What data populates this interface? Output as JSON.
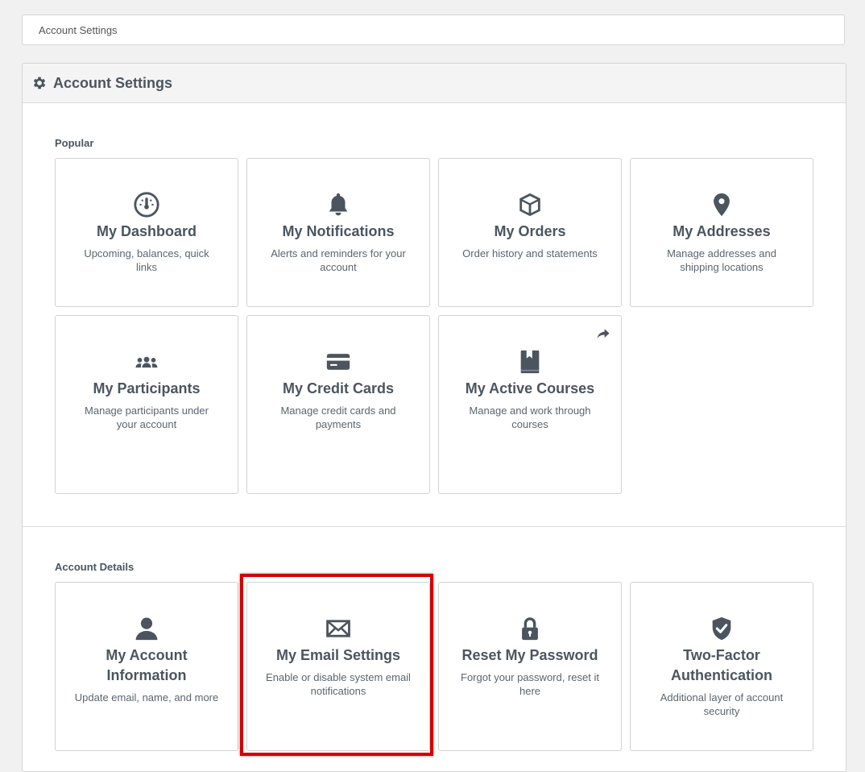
{
  "breadcrumb": {
    "label": "Account Settings"
  },
  "panel": {
    "title": "Account Settings",
    "icon": "gear-icon"
  },
  "sections": {
    "popular": {
      "label": "Popular",
      "cards": [
        {
          "title": "My Dashboard",
          "desc": "Upcoming, balances, quick links",
          "icon": "dashboard-gauge-icon"
        },
        {
          "title": "My Notifications",
          "desc": "Alerts and reminders for your account",
          "icon": "bell-icon"
        },
        {
          "title": "My Orders",
          "desc": "Order history and statements",
          "icon": "box-icon"
        },
        {
          "title": "My Addresses",
          "desc": "Manage addresses and shipping locations",
          "icon": "map-pin-icon"
        },
        {
          "title": "My Participants",
          "desc": "Manage participants under your account",
          "icon": "users-icon"
        },
        {
          "title": "My Credit Cards",
          "desc": "Manage credit cards and payments",
          "icon": "credit-card-icon"
        },
        {
          "title": "My Active Courses",
          "desc": "Manage and work through courses",
          "icon": "book-icon",
          "external_icon": "share-arrow-icon"
        }
      ]
    },
    "account_details": {
      "label": "Account Details",
      "cards": [
        {
          "title": "My Account Information",
          "desc": "Update email, name, and more",
          "icon": "user-icon"
        },
        {
          "title": "My Email Settings",
          "desc": "Enable or disable system email notifications",
          "icon": "envelope-icon"
        },
        {
          "title": "Reset My Password",
          "desc": "Forgot your password, reset it here",
          "icon": "lock-icon"
        },
        {
          "title": "Two-Factor Authentication",
          "desc": "Additional layer of account security",
          "icon": "shield-check-icon"
        }
      ]
    }
  },
  "colors": {
    "icon": "#4b5560",
    "highlight": "#d40000",
    "background": "#f1f1f1"
  }
}
